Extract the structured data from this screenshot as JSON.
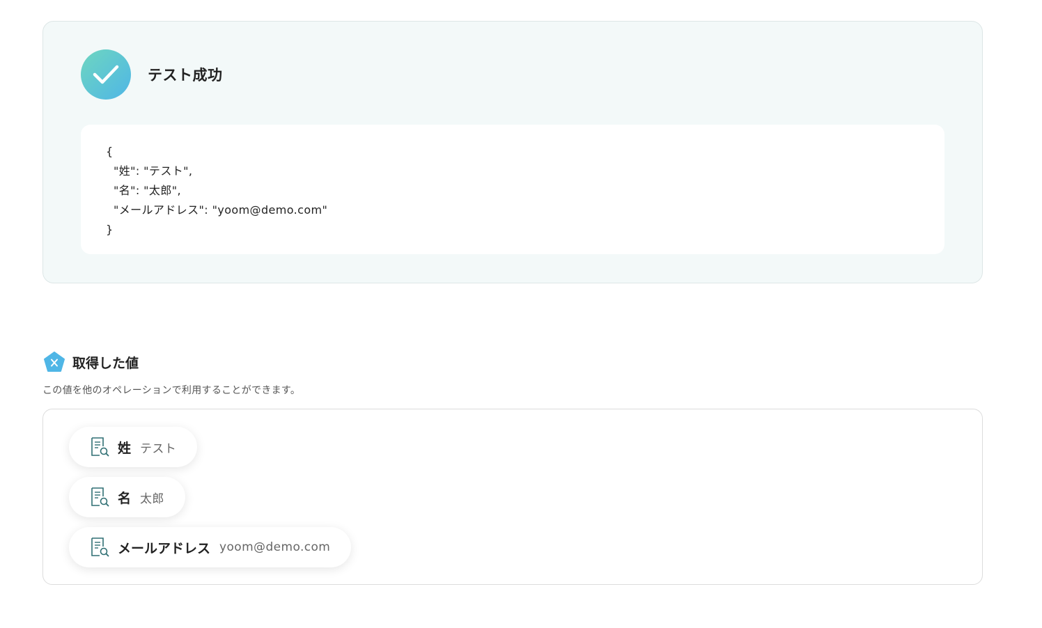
{
  "result": {
    "title": "テスト成功",
    "icon": "check-icon",
    "code_lines": [
      "{",
      "  \"姓\": \"テスト\",",
      "  \"名\": \"太郎\",",
      "  \"メールアドレス\": \"yoom@demo.com\"",
      "}"
    ]
  },
  "values": {
    "icon": "variable-pentagon-icon",
    "title": "取得した値",
    "description": "この値を他のオペレーションで利用することができます。",
    "items": [
      {
        "label": "姓",
        "value": "テスト",
        "icon": "document-search-icon"
      },
      {
        "label": "名",
        "value": "太郎",
        "icon": "document-search-icon"
      },
      {
        "label": "メールアドレス",
        "value": "yoom@demo.com",
        "icon": "document-search-icon"
      }
    ]
  },
  "colors": {
    "panel_bg": "#f3f9f9",
    "accent_start": "#6ed6c0",
    "accent_end": "#4fb6e6",
    "icon_teal": "#2f6f73"
  }
}
